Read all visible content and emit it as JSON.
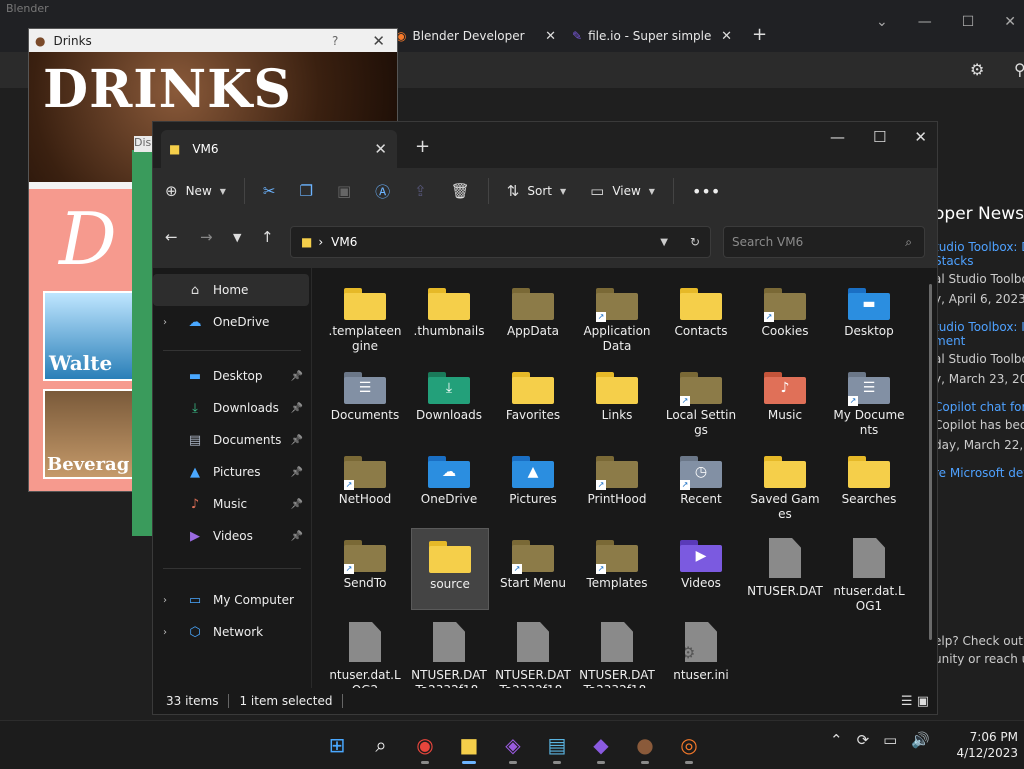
{
  "browser": {
    "title": "Blender",
    "tabs": [
      {
        "label": "Blender Developer"
      },
      {
        "label": "file.io - Super simple"
      }
    ],
    "dev_news": {
      "heading": "oper News",
      "items": [
        {
          "title": "tudio Toolbox: De",
          "title2": "Stacks",
          "text": "al Studio Toolbox",
          "date": "y, April 6, 2023"
        },
        {
          "title": "tudio Toolbox: Int",
          "title2": "ment",
          "text": "al Studio Toolbox",
          "date": "y, March 23, 2023"
        },
        {
          "title": "Copilot chat for V",
          "title2": "",
          "text": "Copilot has becor",
          "date": "day, March 22, 20"
        }
      ],
      "more": "re Microsoft dev",
      "help1": "elp? Check out th",
      "help2": "unity or reach us"
    }
  },
  "drinks": {
    "title": "Drinks",
    "logo": "DRINKS",
    "letter": "D",
    "water_label": "Walte",
    "bev_label": "Beverag",
    "disc_label": "Dis"
  },
  "explorer": {
    "tab_title": "VM6",
    "commands": {
      "new": "New",
      "sort": "Sort",
      "view": "View"
    },
    "address_path": "VM6",
    "search_placeholder": "Search VM6",
    "nav": [
      {
        "label": "Home",
        "icon": "home-icon"
      },
      {
        "label": "OneDrive",
        "icon": "cloud-icon"
      },
      {
        "label": "Desktop",
        "icon": "desktop-icon"
      },
      {
        "label": "Downloads",
        "icon": "download-icon"
      },
      {
        "label": "Documents",
        "icon": "documents-icon"
      },
      {
        "label": "Pictures",
        "icon": "pictures-icon"
      },
      {
        "label": "Music",
        "icon": "music-icon"
      },
      {
        "label": "Videos",
        "icon": "videos-icon"
      },
      {
        "label": "My Computer",
        "icon": "computer-icon"
      },
      {
        "label": "Network",
        "icon": "network-icon"
      }
    ],
    "items": [
      {
        "name": ".templateengine",
        "kind": "folder",
        "color": "yellow"
      },
      {
        "name": ".thumbnails",
        "kind": "folder",
        "color": "yellow"
      },
      {
        "name": "AppData",
        "kind": "folder",
        "color": "dim"
      },
      {
        "name": "Application Data",
        "kind": "folder",
        "color": "dim",
        "shortcut": true
      },
      {
        "name": "Contacts",
        "kind": "folder",
        "color": "yellow"
      },
      {
        "name": "Cookies",
        "kind": "folder",
        "color": "dim",
        "shortcut": true
      },
      {
        "name": "Desktop",
        "kind": "folder",
        "color": "blue"
      },
      {
        "name": "Documents",
        "kind": "folder",
        "color": "gray"
      },
      {
        "name": "Downloads",
        "kind": "folder",
        "color": "green"
      },
      {
        "name": "Favorites",
        "kind": "folder",
        "color": "yellow"
      },
      {
        "name": "Links",
        "kind": "folder",
        "color": "yellow"
      },
      {
        "name": "Local Settings",
        "kind": "folder",
        "color": "dim",
        "shortcut": true
      },
      {
        "name": "Music",
        "kind": "folder",
        "color": "orange"
      },
      {
        "name": "My Documents",
        "kind": "folder",
        "color": "gray",
        "shortcut": true
      },
      {
        "name": "NetHood",
        "kind": "folder",
        "color": "dim",
        "shortcut": true
      },
      {
        "name": "OneDrive",
        "kind": "folder",
        "color": "blue"
      },
      {
        "name": "Pictures",
        "kind": "folder",
        "color": "blue"
      },
      {
        "name": "PrintHood",
        "kind": "folder",
        "color": "dim",
        "shortcut": true
      },
      {
        "name": "Recent",
        "kind": "folder",
        "color": "gray",
        "shortcut": true
      },
      {
        "name": "Saved Games",
        "kind": "folder",
        "color": "yellow"
      },
      {
        "name": "Searches",
        "kind": "folder",
        "color": "yellow"
      },
      {
        "name": "SendTo",
        "kind": "folder",
        "color": "dim",
        "shortcut": true
      },
      {
        "name": "source",
        "kind": "folder",
        "color": "yellow",
        "selected": true
      },
      {
        "name": "Start Menu",
        "kind": "folder",
        "color": "dim",
        "shortcut": true
      },
      {
        "name": "Templates",
        "kind": "folder",
        "color": "dim",
        "shortcut": true
      },
      {
        "name": "Videos",
        "kind": "folder",
        "color": "purple"
      },
      {
        "name": "NTUSER.DAT",
        "kind": "file"
      },
      {
        "name": "ntuser.dat.LOG1",
        "kind": "file"
      },
      {
        "name": "ntuser.dat.LOG2",
        "kind": "file"
      },
      {
        "name": "NTUSER.DATTa2332f18-",
        "kind": "file"
      },
      {
        "name": "NTUSER.DATTa2332f18-",
        "kind": "file"
      },
      {
        "name": "NTUSER.DATTa2332f18-",
        "kind": "file"
      },
      {
        "name": "ntuser.ini",
        "kind": "file",
        "gear": true
      }
    ],
    "status": {
      "count": "33 items",
      "selected": "1 item selected"
    }
  },
  "taskbar": {
    "apps": [
      "windows-start",
      "search",
      "chrome",
      "file-explorer",
      "visual-studio-code",
      "notepad",
      "visual-studio",
      "drinks-app",
      "blender"
    ],
    "time": "7:06 PM",
    "date": "4/12/2023"
  },
  "colors": {
    "accent": "#6cb4ff",
    "folder_yellow": "#f5cf4a",
    "selection": "#444444"
  }
}
